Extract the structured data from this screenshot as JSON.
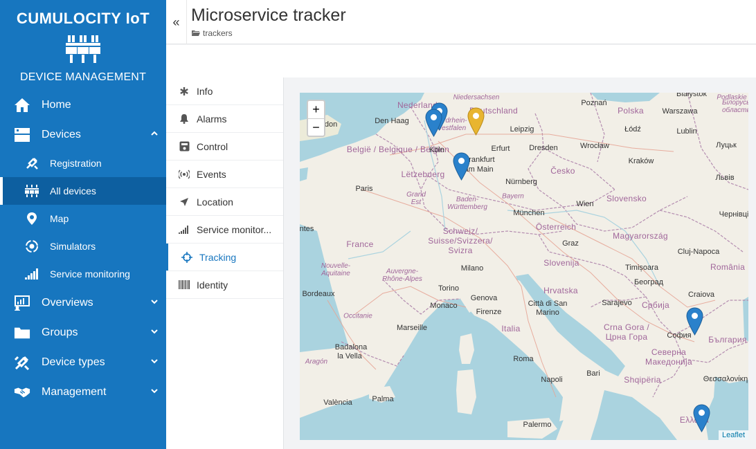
{
  "brand": {
    "name": "CUMULOCITY IoT",
    "subtitle": "DEVICE MANAGEMENT"
  },
  "sidebar": {
    "items": [
      {
        "label": "Home",
        "icon": "home-icon"
      },
      {
        "label": "Devices",
        "icon": "devices-icon",
        "expanded": true
      },
      {
        "label": "Registration",
        "icon": "registration-icon",
        "sub": true
      },
      {
        "label": "All devices",
        "icon": "all-devices-icon",
        "sub": true,
        "active": true
      },
      {
        "label": "Map",
        "icon": "map-pin-icon",
        "sub": true
      },
      {
        "label": "Simulators",
        "icon": "simulators-icon",
        "sub": true
      },
      {
        "label": "Service monitoring",
        "icon": "signal-icon",
        "sub": true
      },
      {
        "label": "Overviews",
        "icon": "overviews-icon"
      },
      {
        "label": "Groups",
        "icon": "folder-icon"
      },
      {
        "label": "Device types",
        "icon": "device-types-icon"
      },
      {
        "label": "Management",
        "icon": "handshake-icon"
      }
    ]
  },
  "header": {
    "collapse": "«",
    "title": "Microservice tracker",
    "breadcrumb": "trackers"
  },
  "tabs": [
    {
      "label": "Info",
      "icon": "asterisk-icon"
    },
    {
      "label": "Alarms",
      "icon": "bell-icon"
    },
    {
      "label": "Control",
      "icon": "control-icon"
    },
    {
      "label": "Events",
      "icon": "broadcast-icon"
    },
    {
      "label": "Location",
      "icon": "location-arrow-icon"
    },
    {
      "label": "Service monitor...",
      "icon": "signal-icon"
    },
    {
      "label": "Tracking",
      "icon": "crosshair-icon",
      "active": true
    },
    {
      "label": "Identity",
      "icon": "barcode-icon"
    }
  ],
  "map": {
    "zoom_in": "+",
    "zoom_out": "−",
    "attribution": "Leaflet",
    "cities": [
      "Den Haag",
      "Köln",
      "Leipzig",
      "Poznań",
      "Białystok",
      "Warszawa",
      "Łódź",
      "Lublin",
      "Луцьк",
      "Wrocław",
      "Dresden",
      "Erfurt",
      "Frankfurt am Main",
      "Kraków",
      "Львів",
      "Nürnberg",
      "Paris",
      "Wien",
      "München",
      "Чернівці",
      "Graz",
      "Cluj-Napoca",
      "Milano",
      "Torino",
      "Genova",
      "Timișoara",
      "Београд",
      "Bordeaux",
      "Monaco",
      "Firenze",
      "Città di San Marino",
      "Sarajevo",
      "Craiova",
      "Marseille",
      "Roma",
      "София",
      "Badalona",
      "la Vella",
      "Bari",
      "Napoli",
      "Θεσσαλονίκη",
      "València",
      "Palma",
      "Palermo",
      "ndon",
      "ntes"
    ],
    "countries": [
      "Nederland",
      "Deutschland",
      "Polska",
      "België / Belgique / Belgien",
      "Lëtzebuerg",
      "Česko",
      "Slovensko",
      "France",
      "Schweiz/ Suisse/Svizzera/ Svizra",
      "Österreich",
      "Magyarország",
      "Slovenija",
      "Hrvatska",
      "România",
      "Србија",
      "Italia",
      "Crna Gora / Црна Гора",
      "България",
      "Северна Македонија",
      "Shqipëria",
      "Ελλάδα"
    ],
    "regions": [
      "Niedersachsen",
      "Nordrhein-Westfalen",
      "Grand Est",
      "Bayern",
      "Baden-Württemberg",
      "Nouvelle-Aquitaine",
      "Auvergne-Rhône-Alpes",
      "Occitanie",
      "Aragón",
      "Podlaskie",
      "Білоруська область"
    ],
    "markers": [
      {
        "name": "marker-nrw-1",
        "color": "#2a81cb"
      },
      {
        "name": "marker-nrw-2",
        "color": "#2a81cb"
      },
      {
        "name": "marker-thuringia",
        "color": "#e8b530"
      },
      {
        "name": "marker-frankfurt",
        "color": "#2a81cb"
      },
      {
        "name": "marker-sofia",
        "color": "#2a81cb"
      },
      {
        "name": "marker-greece",
        "color": "#2a81cb"
      }
    ]
  },
  "colors": {
    "sidebar": "#1776bf",
    "accent": "#1776bf",
    "marker_blue": "#2a81cb",
    "marker_gold": "#e8b530"
  }
}
